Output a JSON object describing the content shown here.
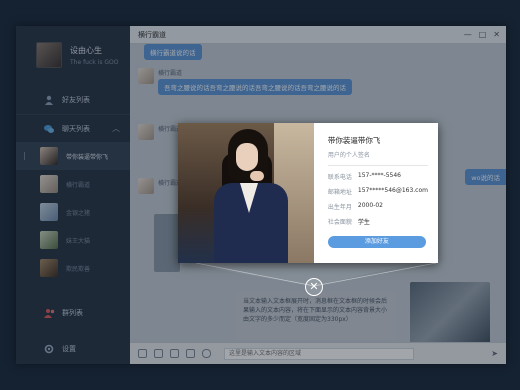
{
  "profile": {
    "name": "设由心生",
    "signature": "The fuck is GOO"
  },
  "nav": {
    "friends": "好友列表",
    "chats": "聊天列表",
    "groups": "群列表",
    "settings": "设置"
  },
  "chat_list": [
    {
      "label": "带你装逼带你飞",
      "selected": true
    },
    {
      "label": "横行霸道",
      "selected": false
    },
    {
      "label": "金银之猪",
      "selected": false
    },
    {
      "label": "妹王大猫",
      "selected": false
    },
    {
      "label": "欺民欺善",
      "selected": false
    }
  ],
  "window": {
    "title": "横行霸道",
    "controls": [
      "—",
      "□",
      "✕"
    ]
  },
  "messages": [
    {
      "text": "横行霸道说的话"
    },
    {
      "name": "横行霸道",
      "text": "吾弯之腰说的话吾弯之腰说的话吾弯之腰说的话吾弯之腰说的话"
    },
    {
      "name": "横行霸道"
    },
    {
      "name": "横行霸道"
    }
  ],
  "side_bubble": "wo说的话",
  "text_note": "当文本输入文本框展开时，消息框在文本框的时候会后果输入的文本内容，将在下面显示的文本内容背景大小由文字的多少而定（宽度固定为330px）",
  "input": {
    "placeholder": "这里是输入文本内容的区域",
    "send_icon": "send-icon"
  },
  "card": {
    "name": "带你装逼带你飞",
    "signature": "用户的个人签名",
    "fields": [
      {
        "k": "联系电话",
        "v": "157-****-5546"
      },
      {
        "k": "邮箱地址",
        "v": "157*****546@163.com"
      },
      {
        "k": "出生年月",
        "v": "2000-02"
      },
      {
        "k": "社会面貌",
        "v": "学生"
      }
    ],
    "add_button": "添加好友"
  },
  "close_glyph": "✕"
}
